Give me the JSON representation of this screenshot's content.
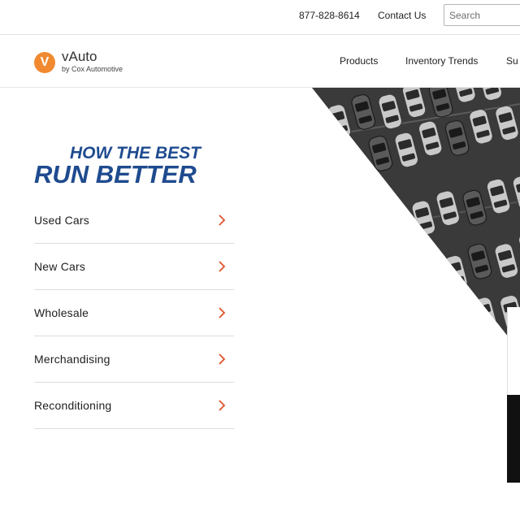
{
  "topbar": {
    "phone": "877-828-8614",
    "contact_label": "Contact Us",
    "search_placeholder": "Search"
  },
  "brand": {
    "badge_letter": "V",
    "name": "vAuto",
    "tagline": "by Cox Automotive",
    "accent_color": "#f0892f"
  },
  "nav": {
    "products": "Products",
    "inventory_trends": "Inventory Trends",
    "solutions_partial": "Su"
  },
  "hero": {
    "headline_line1": "HOW THE BEST",
    "headline_line2": "RUN BETTER",
    "headline_color": "#1f4b8f"
  },
  "menu": {
    "items": [
      {
        "label": "Used Cars",
        "icon": "chevron-right-icon"
      },
      {
        "label": "New Cars",
        "icon": "chevron-right-icon"
      },
      {
        "label": "Wholesale",
        "icon": "chevron-right-icon"
      },
      {
        "label": "Merchandising",
        "icon": "chevron-right-icon"
      },
      {
        "label": "Reconditioning",
        "icon": "chevron-right-icon"
      }
    ],
    "chevron_color": "#e0522a"
  }
}
